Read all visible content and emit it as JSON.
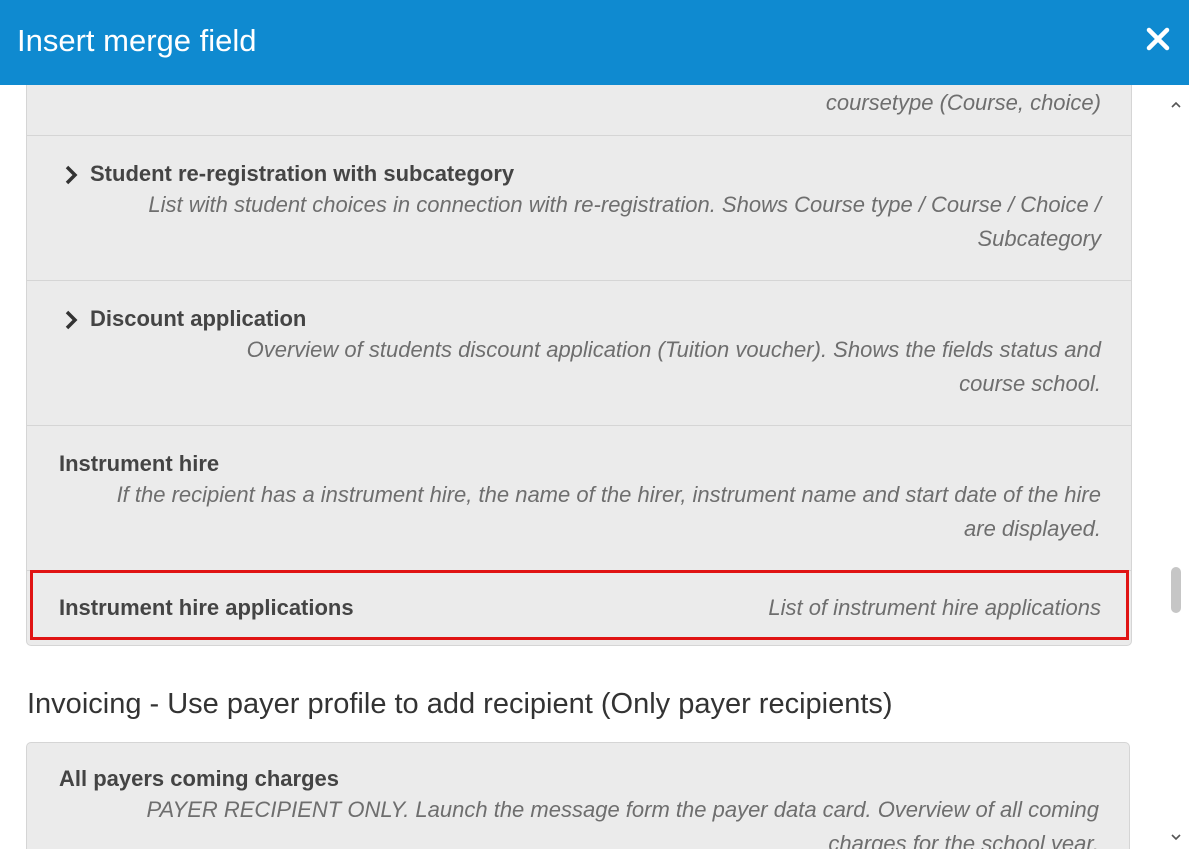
{
  "dialog": {
    "title": "Insert merge field",
    "close_icon": "close-icon"
  },
  "list": {
    "items": [
      {
        "title": "",
        "description": "coursetype (Course, choice)",
        "expandable": false
      },
      {
        "title": "Student re-registration with subcategory",
        "description": "List with student choices in connection with re-registration. Shows Course type / Course / Choice / Subcategory",
        "expandable": true
      },
      {
        "title": "Discount application",
        "description": "Overview of students discount application (Tuition voucher). Shows the fields status and course school.",
        "expandable": true
      },
      {
        "title": "Instrument hire",
        "description": "If the recipient has a instrument hire, the name of the hirer, instrument name and start date of the hire are displayed.",
        "expandable": false
      },
      {
        "title": "Instrument hire applications",
        "description": "List of instrument hire applications",
        "expandable": false,
        "highlighted": true
      }
    ]
  },
  "invoicing": {
    "heading": "Invoicing - Use payer profile to add recipient (Only payer recipients)",
    "items": [
      {
        "title": "All payers coming charges",
        "description": "PAYER RECIPIENT ONLY. Launch the message form the payer data card. Overview of all coming charges for the school year."
      }
    ]
  },
  "colors": {
    "header": "#0f8ad0",
    "highlight": "#e01414",
    "card_bg": "#ebebeb"
  }
}
